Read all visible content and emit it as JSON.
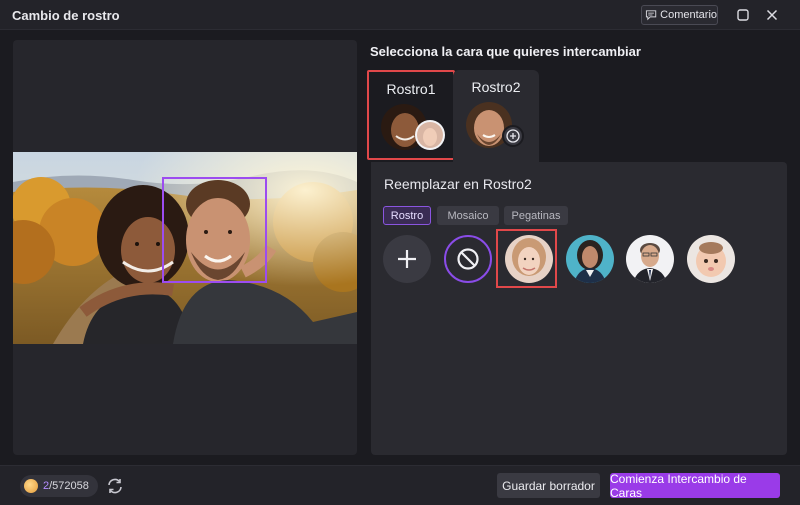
{
  "window": {
    "title": "Cambio de rostro",
    "comment_label": "Comentario"
  },
  "main": {
    "select_prompt": "Selecciona la cara que quieres intercambiar",
    "face_tabs": [
      {
        "label": "Rostro1"
      },
      {
        "label": "Rostro2"
      }
    ],
    "replace_title": "Reemplazar en Rostro2",
    "categories": [
      "Rostro",
      "Mosaico",
      "Pegatinas"
    ]
  },
  "footer": {
    "credits_used": "2",
    "credits_total": "/572058",
    "save_draft_label": "Guardar borrador",
    "start_label": "Comienza Intercambio de Caras"
  },
  "colors": {
    "accent": "#9a3be8",
    "highlight": "#e1484a",
    "background": "#1b1b20"
  }
}
